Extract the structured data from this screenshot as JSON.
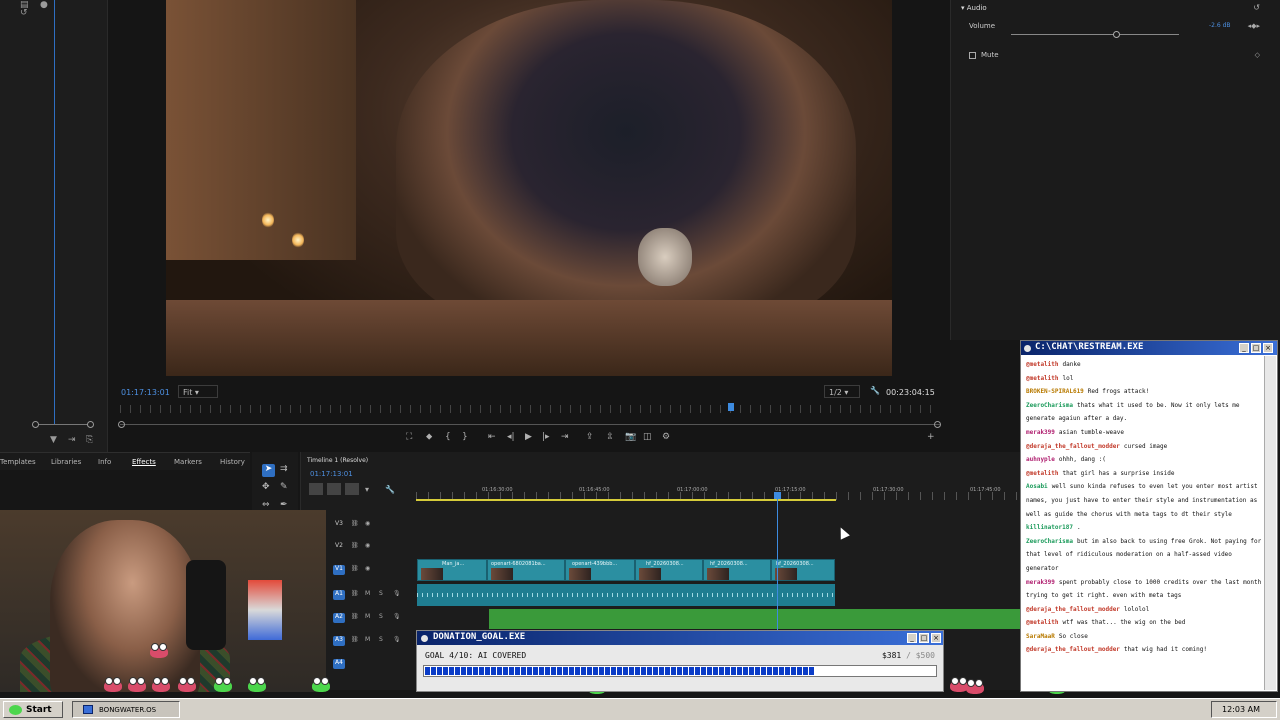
{
  "monitor": {
    "timecode_current": "01:17:13:01",
    "fit": "Fit",
    "resolution": "1/2",
    "duration": "00:23:04:15"
  },
  "effect_controls": {
    "section": "Audio",
    "volume_label": "Volume",
    "volume_value": "-2.6 dB",
    "volume_level": 0.6,
    "mute_label": "Mute"
  },
  "panel_tabs": [
    "Templates",
    "Libraries",
    "Info",
    "Effects",
    "Markers",
    "History"
  ],
  "timeline": {
    "tab_title": "Timeline 1 (Resolve)",
    "timecode": "01:17:13:01",
    "ticks": [
      "01:16:30:00",
      "01:16:45:00",
      "01:17:00:00",
      "01:17:15:00",
      "01:17:30:00",
      "01:17:45:00"
    ],
    "tracks": [
      {
        "label": "V3"
      },
      {
        "label": "V2"
      },
      {
        "label": "V1"
      },
      {
        "label": "A1"
      },
      {
        "label": "A2"
      },
      {
        "label": "A3"
      },
      {
        "label": "A4"
      }
    ],
    "clips": [
      "Man_ja...",
      "openart-6802081ba...",
      "openart-439bbb...",
      "hf_20260308...",
      "hf_20260308...",
      "hf_20260308..."
    ]
  },
  "donation": {
    "title": "DONATION_GOAL.EXE",
    "goal_text": "GOAL 4/10: AI COVERED",
    "current": "$381",
    "separator": "/",
    "target": "$500",
    "progress": 0.762
  },
  "chat": {
    "title": "C:\\CHAT\\RESTREAM.EXE",
    "messages": [
      {
        "user": "@metalith",
        "text": "danke",
        "color": "#c23a2a"
      },
      {
        "user": "@metalith",
        "text": "lol",
        "color": "#c23a2a"
      },
      {
        "user": "BROKEN-SPIRAL619",
        "text": "Red frogs attack!",
        "color": "#b87a00"
      },
      {
        "user": "ZeeroCharisma",
        "text": "thats what it used to be. Now it only lets me generate agaiun after a day.",
        "color": "#1a9a5a"
      },
      {
        "user": "merak399",
        "text": "asian tumble-weave",
        "color": "#b02070"
      },
      {
        "user": "@deraja_the_fallout_modder",
        "text": "cursed image",
        "color": "#c23a2a"
      },
      {
        "user": "auhnyple",
        "text": "ohhh, dang :(",
        "color": "#b02070"
      },
      {
        "user": "@metalith",
        "text": "that girl has a surprise inside",
        "color": "#c23a2a"
      },
      {
        "user": "Aosabi",
        "text": "well suno kinda refuses to even let you enter most artist names, you just have to enter their style and instrumentation as well as guide the chorus with meta tags to dt their style",
        "color": "#1a9a5a"
      },
      {
        "user": "killinator187",
        "text": ".",
        "color": "#1a9a5a"
      },
      {
        "user": "ZeeroCharisma",
        "text": "but im also back to using free Grok. Not paying for that level of ridiculous moderation on a half-assed video generator",
        "color": "#1a9a5a"
      },
      {
        "user": "merak399",
        "text": "spent probably close to 1000 credits over the last month trying to get it right. even with meta tags",
        "color": "#b02070"
      },
      {
        "user": "@deraja_the_fallout_modder",
        "text": "lololol",
        "color": "#c23a2a"
      },
      {
        "user": "@metalith",
        "text": "wtf was that... the wig on the bed",
        "color": "#c23a2a"
      },
      {
        "user": "SaraMaaR",
        "text": "So close",
        "color": "#b87a00"
      },
      {
        "user": "@deraja_the_fallout_modder",
        "text": "that wig had it coming!",
        "color": "#c23a2a"
      }
    ]
  },
  "taskbar": {
    "start": "Start",
    "task": "BONGWATER.OS",
    "clock": "12:03 AM"
  },
  "icons": {
    "start": "frog-icon",
    "task": "window-icon",
    "wrench": "wrench-icon",
    "play": "play-icon"
  }
}
